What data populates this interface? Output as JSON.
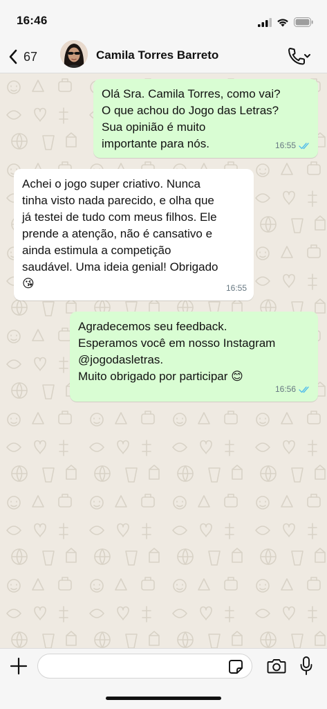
{
  "status_bar": {
    "time": "16:46"
  },
  "header": {
    "back_count": "67",
    "contact_name": "Camila Torres Barreto"
  },
  "messages": [
    {
      "direction": "outgoing",
      "lines": [
        "Olá Sra. Camila Torres, como vai?",
        "O que achou do Jogo das Letras?",
        "Sua opinião é muito",
        "importante para nós."
      ],
      "time": "16:55",
      "status": "read"
    },
    {
      "direction": "incoming",
      "lines": [
        "Achei o jogo super criativo. Nunca",
        "tinha visto nada parecido, e olha que",
        "já testei de tudo com meus filhos. Ele",
        "prende a atenção, não é cansativo e",
        "ainda estimula a competição",
        "saudável. Uma ideia genial! Obrigado",
        "😘"
      ],
      "time": "16:55"
    },
    {
      "direction": "outgoing",
      "lines": [
        "Agradecemos seu feedback.",
        "Esperamos você em nosso Instagram",
        "@jogodasletras.",
        "Muito obrigado por participar 😊"
      ],
      "time": "16:56",
      "status": "read"
    }
  ],
  "input": {
    "value": "",
    "placeholder": ""
  },
  "icons": {
    "back": "chevron-left-icon",
    "call": "phone-icon",
    "plus": "plus-icon",
    "sticker": "sticker-icon",
    "camera": "camera-icon",
    "mic": "microphone-icon",
    "read_receipt": "double-check-icon"
  },
  "colors": {
    "outgoing_bubble": "#d9fdd3",
    "incoming_bubble": "#ffffff",
    "wallpaper": "#efeae2",
    "read_tick": "#53bdeb",
    "meta_text": "#667781"
  }
}
